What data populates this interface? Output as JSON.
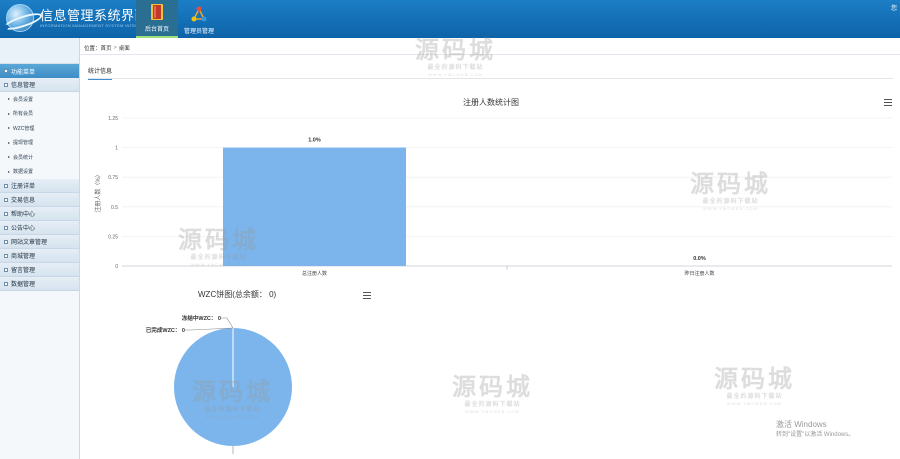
{
  "header": {
    "title": "信息管理系统界面",
    "subtitle": "INFORMATION MANAGEMENT SYSTEM INTERFACE",
    "nav": [
      {
        "label": "后台首页",
        "active": true
      },
      {
        "label": "管理员管理",
        "active": false
      }
    ],
    "user_text": "您"
  },
  "sidebar": {
    "menu_label": "功能菜单",
    "groups": [
      {
        "label": "信息管理"
      },
      {
        "label": "注册详单"
      },
      {
        "label": "交易信息"
      },
      {
        "label": "帮助中心"
      },
      {
        "label": "公告中心"
      },
      {
        "label": "网站文章管理"
      },
      {
        "label": "商城管理"
      },
      {
        "label": "留言管理"
      },
      {
        "label": "数据管理"
      }
    ],
    "sub_items": [
      "会员设置",
      "所有会员",
      "WZC管理",
      "提现管理",
      "会员统计",
      "数据设置"
    ]
  },
  "breadcrumb": {
    "prefix": "位置：",
    "home": "首页",
    "current": "桌面"
  },
  "tab": {
    "label": "统计信息"
  },
  "bar_chart": {
    "title": "注册人数统计图",
    "ylabel": "注册人数（%）",
    "yticks": [
      "1.25",
      "1",
      "0.75",
      "0.5",
      "0.25",
      "0"
    ],
    "categories": [
      "总注册人数",
      "昨日注册人数"
    ],
    "data_labels": [
      "1.0%",
      "0.0%"
    ],
    "bar_color": "#7cb5ec"
  },
  "pie_chart": {
    "title": "WZC饼图(总余额： 0)",
    "labels": [
      "冻结中WZC： 0",
      "已完成WZC： 0"
    ],
    "color": "#7cb5ec"
  },
  "chart_data": [
    {
      "type": "bar",
      "title": "注册人数统计图",
      "ylabel": "注册人数（%）",
      "categories": [
        "总注册人数",
        "昨日注册人数"
      ],
      "values": [
        1.0,
        0.0
      ],
      "ylim": [
        0,
        1.25
      ],
      "grid": true
    },
    {
      "type": "pie",
      "title": "WZC饼图(总余额： 0)",
      "labels": [
        "冻结中WZC",
        "已完成WZC"
      ],
      "values": [
        0,
        0
      ]
    }
  ],
  "watermark": {
    "big": "源码城",
    "mid": "最全的源码下载站",
    "small": "WWW.YMCWEB.COM"
  },
  "os_notice": {
    "line1": "激活 Windows",
    "line2": "转到\"设置\"以激活 Windows。"
  }
}
